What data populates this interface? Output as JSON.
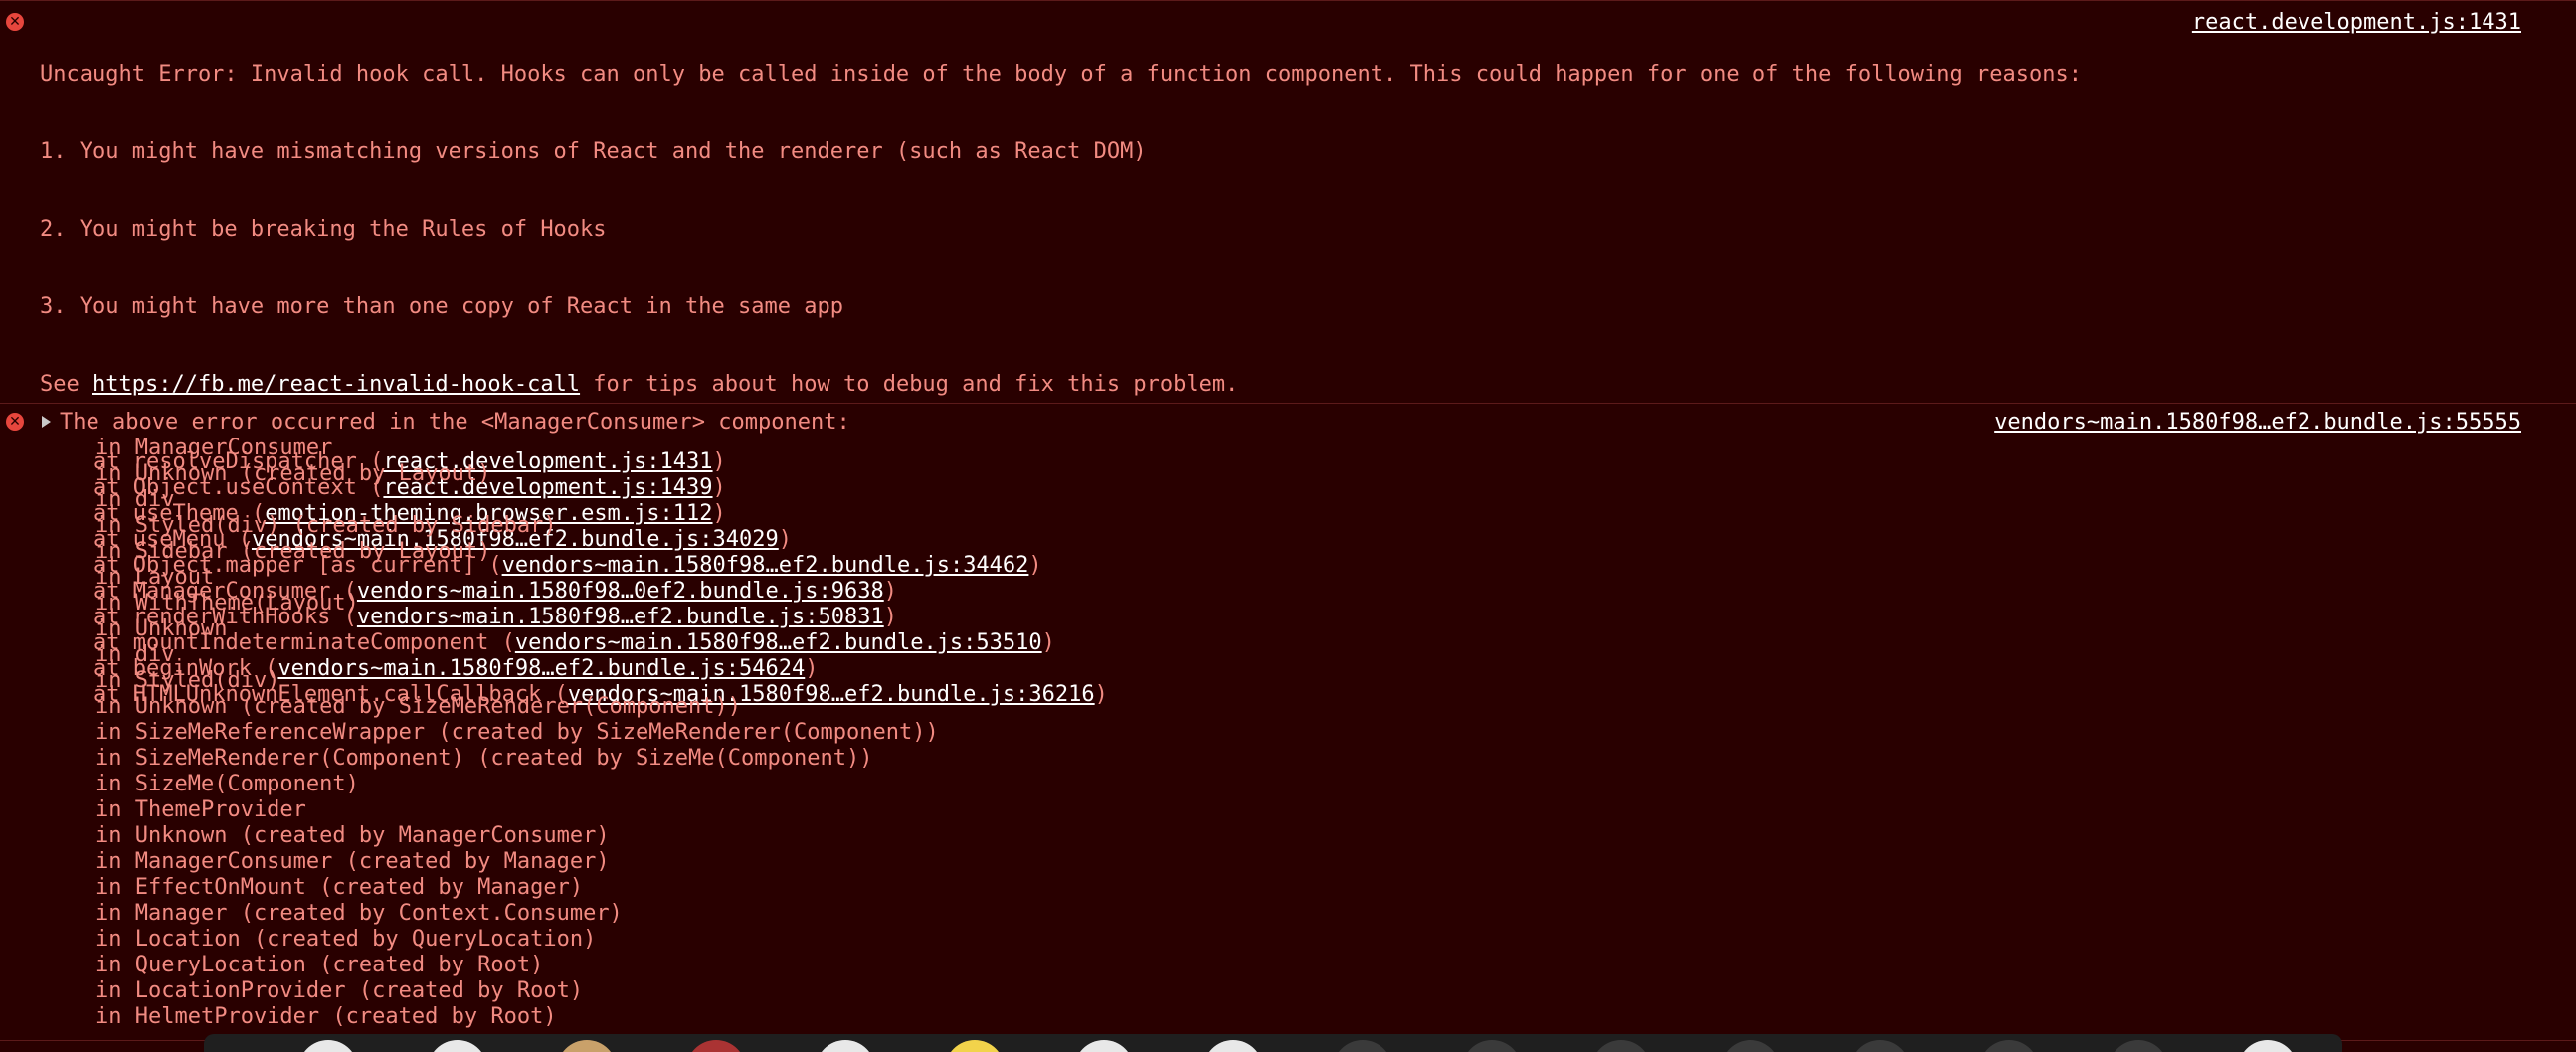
{
  "console": {
    "error1": {
      "message": [
        "Uncaught Error: Invalid hook call. Hooks can only be called inside of the body of a function component. This could happen for one of the following reasons:",
        "1. You might have mismatching versions of React and the renderer (such as React DOM)",
        "2. You might be breaking the Rules of Hooks",
        "3. You might have more than one copy of React in the same app"
      ],
      "see_prefix": "See ",
      "see_link": "https://fb.me/react-invalid-hook-call",
      "see_suffix": " for tips about how to debug and fix this problem.",
      "source": "react.development.js:1431",
      "frames": [
        {
          "text": "at resolveDispatcher (",
          "link": "react.development.js:1431",
          "close": ")"
        },
        {
          "text": "at Object.useContext (",
          "link": "react.development.js:1439",
          "close": ")"
        },
        {
          "text": "at useTheme (",
          "link": "emotion-theming.browser.esm.js:112",
          "close": ")"
        },
        {
          "text": "at useMenu (",
          "link": "vendors~main.1580f98…ef2.bundle.js:34029",
          "close": ")"
        },
        {
          "text": "at Object.mapper [as current] (",
          "link": "vendors~main.1580f98…ef2.bundle.js:34462",
          "close": ")"
        },
        {
          "text": "at ManagerConsumer (",
          "link": "vendors~main.1580f98…0ef2.bundle.js:9638",
          "close": ")"
        },
        {
          "text": "at renderWithHooks (",
          "link": "vendors~main.1580f98…ef2.bundle.js:50831",
          "close": ")"
        },
        {
          "text": "at mountIndeterminateComponent (",
          "link": "vendors~main.1580f98…ef2.bundle.js:53510",
          "close": ")"
        },
        {
          "text": "at beginWork (",
          "link": "vendors~main.1580f98…ef2.bundle.js:54624",
          "close": ")"
        },
        {
          "text": "at HTMLUnknownElement.callCallback (",
          "link": "vendors~main.1580f98…ef2.bundle.js:36216",
          "close": ")"
        }
      ]
    },
    "error2": {
      "summary": "The above error occurred in the <ManagerConsumer> component:",
      "source": "vendors~main.1580f98…ef2.bundle.js:55555",
      "component_stack": [
        "in ManagerConsumer",
        "in Unknown (created by Layout)",
        "in div",
        "in Styled(div) (created by Sidebar)",
        "in Sidebar (created by Layout)",
        "in Layout",
        "in WithTheme(Layout)",
        "in Unknown",
        "in div",
        "in Styled(div)",
        "in Unknown (created by SizeMeRenderer(Component))",
        "in SizeMeReferenceWrapper (created by SizeMeRenderer(Component))",
        "in SizeMeRenderer(Component) (created by SizeMe(Component))",
        "in SizeMe(Component)",
        "in ThemeProvider",
        "in Unknown (created by ManagerConsumer)",
        "in ManagerConsumer (created by Manager)",
        "in EffectOnMount (created by Manager)",
        "in Manager (created by Context.Consumer)",
        "in Location (created by QueryLocation)",
        "in QueryLocation (created by Root)",
        "in LocationProvider (created by Root)",
        "in HelmetProvider (created by Root)"
      ]
    },
    "icons": {
      "error": "error-circle-icon",
      "expand": "expand-triangle-icon"
    },
    "colors": {
      "background": "#290000",
      "text": "#f28b82",
      "link": "#ffffff",
      "error_icon": "#e8463d"
    }
  }
}
